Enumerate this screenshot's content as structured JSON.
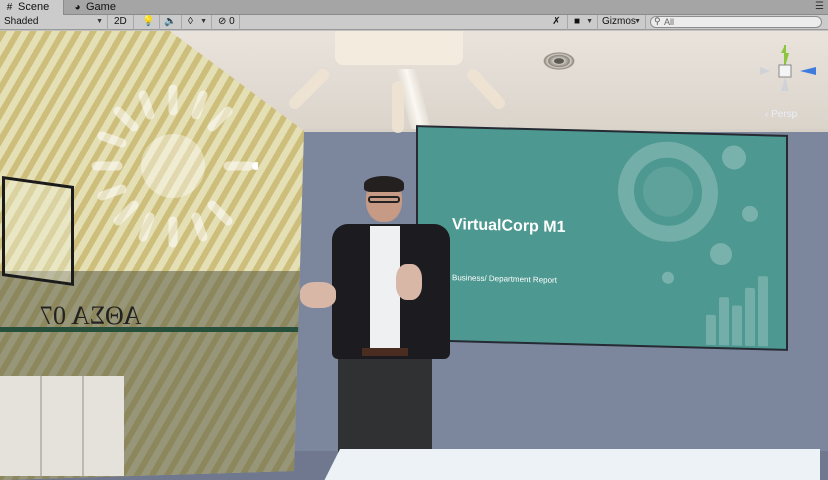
{
  "tabs": [
    {
      "label": "Scene",
      "icon": "grid-icon",
      "active": true
    },
    {
      "label": "Game",
      "icon": "pacman-icon",
      "active": false
    }
  ],
  "toolbar": {
    "shading_mode": "Shaded",
    "view_2d_label": "2D",
    "hidden_count": "0",
    "gizmos_label": "Gizmos",
    "search_placeholder": "All"
  },
  "viewport": {
    "slide_title": "VirtualCorp M1",
    "slide_subtitle": "Business/ Department Report",
    "projection_label": "‹ Persp",
    "glass_lettering": "ΑΘΣΑ 07"
  },
  "colors": {
    "slide_bg": "#4d9890",
    "wall": "#7c879d",
    "axis_y": "#8cc63f",
    "axis_x": "#e24a3b",
    "axis_z": "#3d7bdc"
  }
}
